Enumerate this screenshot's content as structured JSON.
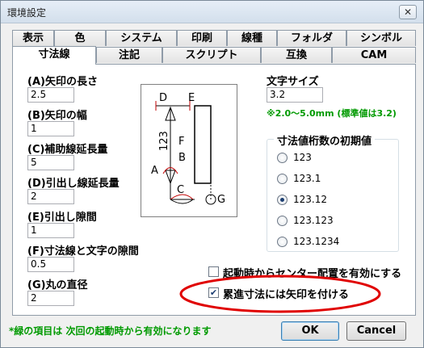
{
  "window": {
    "title": "環境設定",
    "close": "✕"
  },
  "tabs": {
    "row_back": [
      "表示",
      "色",
      "システム",
      "印刷",
      "線種",
      "フォルダ",
      "シンボル"
    ],
    "row_front": [
      "寸法線",
      "注記",
      "スクリプト",
      "互換",
      "CAM"
    ]
  },
  "fields": [
    {
      "label": "(A)矢印の長さ",
      "value": "2.5"
    },
    {
      "label": "(B)矢印の幅",
      "value": "1"
    },
    {
      "label": "(C)補助線延長量",
      "value": "5"
    },
    {
      "label": "(D)引出し線延長量",
      "value": "2"
    },
    {
      "label": "(E)引出し隙間",
      "value": "1"
    },
    {
      "label": "(F)寸法線と文字の隙間",
      "value": "0.5"
    },
    {
      "label": "(G)丸の直径",
      "value": "2"
    }
  ],
  "diagram": {
    "D": "D",
    "E": "E",
    "F": "F",
    "B": "B",
    "A": "A",
    "C": "C",
    "G": "G",
    "dim_text": "123"
  },
  "text_size": {
    "label": "文字サイズ",
    "value": "3.2",
    "note": "※2.0～5.0mm (標準値は3.2)"
  },
  "digits": {
    "title": "寸法値桁数の初期値",
    "options": [
      "123",
      "123.1",
      "123.12",
      "123.123",
      "123.1234"
    ],
    "selected": "123.12"
  },
  "checks": {
    "center_snap": {
      "label": "起動時からセンター配置を有効にする",
      "checked": false
    },
    "arrow_cumulative": {
      "label": "累進寸法には矢印を付ける",
      "checked": true
    }
  },
  "highlight_color": "#e00000",
  "footer": {
    "note": "*緑の項目は 次回の起動時から有効になります"
  },
  "buttons": {
    "ok": "OK",
    "cancel": "Cancel"
  }
}
